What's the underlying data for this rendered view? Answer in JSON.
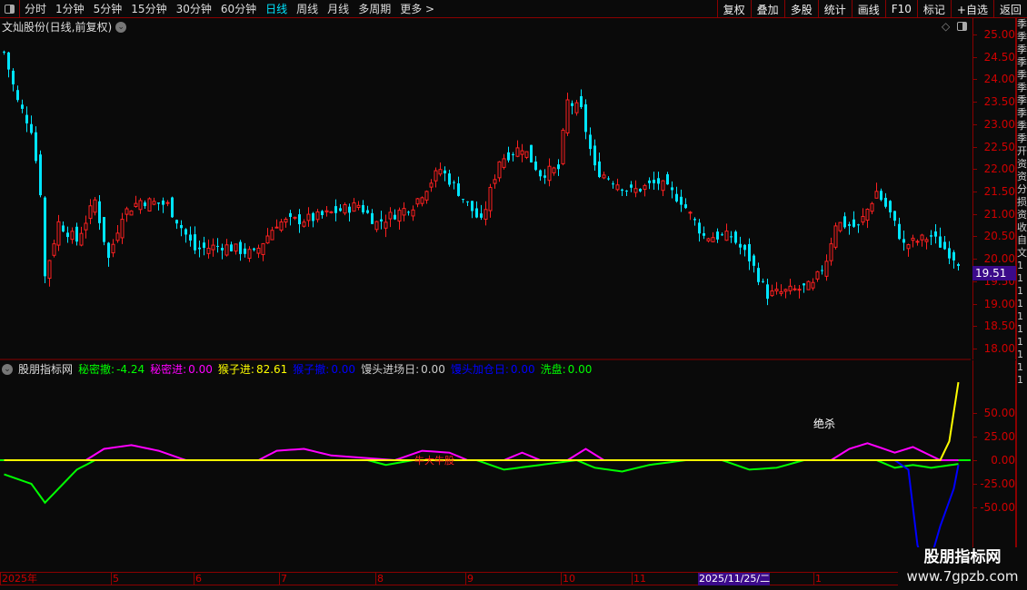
{
  "toolbar": {
    "periods": [
      "分时",
      "1分钟",
      "5分钟",
      "15分钟",
      "30分钟",
      "60分钟",
      "日线",
      "周线",
      "月线",
      "多周期",
      "更多 >"
    ],
    "active": "日线",
    "buttons": [
      "复权",
      "叠加",
      "多股",
      "统计",
      "画线",
      "F10",
      "标记",
      "+自选",
      "返回"
    ]
  },
  "title": "文灿股份(日线,前复权)",
  "price_axis": [
    "25.00",
    "24.50",
    "24.00",
    "23.50",
    "23.00",
    "22.50",
    "22.00",
    "21.50",
    "21.00",
    "20.50",
    "20.00",
    "19.50",
    "19.00",
    "18.50",
    "18.00"
  ],
  "current_price": "19.51",
  "indicator": {
    "name": "股朋指标网",
    "items": [
      {
        "label": "秘密撤:",
        "value": "-4.24",
        "color": "#00ff00"
      },
      {
        "label": "秘密进:",
        "value": "0.00",
        "color": "#ff00ff"
      },
      {
        "label": "猴子进:",
        "value": "82.61",
        "color": "#ffff00"
      },
      {
        "label": "猴子撤:",
        "value": "0.00",
        "color": "#0000ff"
      },
      {
        "label": "馒头进场日:",
        "value": "0.00",
        "color": "#cccccc"
      },
      {
        "label": "馒头加仓日:",
        "value": "0.00",
        "color": "#0000ff"
      },
      {
        "label": "洗盘:",
        "value": "0.00",
        "color": "#00ff00"
      }
    ],
    "axis": [
      "50.00",
      "25.00",
      "0.00",
      "-25.00",
      "-50.00"
    ],
    "annotations": [
      "绝杀",
      "牛大牛股"
    ]
  },
  "dates": [
    "2025年",
    "5",
    "6",
    "7",
    "8",
    "9",
    "10",
    "11",
    "2025/11/25/二",
    "1"
  ],
  "strip": "季季季季季季季季季季开资资分损资收自文1111111111",
  "watermark": {
    "title": "股朋指标网",
    "url": "www.7gpzb.com"
  },
  "colors": {
    "up": "#ff2020",
    "down": "#00e5ff",
    "grid": "#8b0000"
  },
  "chart_data": {
    "type": "candlestick",
    "price_anchors": [
      [
        0,
        24.6
      ],
      [
        3,
        23.5
      ],
      [
        6,
        22.9
      ],
      [
        8,
        21.5
      ],
      [
        9,
        19.6
      ],
      [
        12,
        20.8
      ],
      [
        16,
        20.4
      ],
      [
        20,
        21.3
      ],
      [
        23,
        20.0
      ],
      [
        26,
        21.0
      ],
      [
        30,
        21.3
      ],
      [
        36,
        21.2
      ],
      [
        42,
        20.2
      ],
      [
        48,
        20.3
      ],
      [
        55,
        20.1
      ],
      [
        60,
        20.8
      ],
      [
        68,
        20.9
      ],
      [
        78,
        21.2
      ],
      [
        82,
        20.8
      ],
      [
        90,
        21.2
      ],
      [
        96,
        22.0
      ],
      [
        100,
        21.5
      ],
      [
        105,
        20.8
      ],
      [
        109,
        22.2
      ],
      [
        114,
        22.5
      ],
      [
        118,
        21.9
      ],
      [
        122,
        22.0
      ],
      [
        124,
        23.5
      ],
      [
        127,
        23.3
      ],
      [
        130,
        22.0
      ],
      [
        138,
        21.5
      ],
      [
        144,
        21.7
      ],
      [
        149,
        21.3
      ],
      [
        154,
        20.5
      ],
      [
        160,
        20.5
      ],
      [
        164,
        20.0
      ],
      [
        168,
        19.2
      ],
      [
        174,
        19.3
      ],
      [
        178,
        19.4
      ],
      [
        181,
        20.0
      ],
      [
        183,
        20.8
      ],
      [
        188,
        20.7
      ],
      [
        192,
        21.5
      ],
      [
        195,
        21.0
      ],
      [
        198,
        20.3
      ],
      [
        204,
        20.5
      ],
      [
        210,
        19.95
      ]
    ],
    "ylim": [
      18,
      25
    ],
    "indicator_series": [
      {
        "name": "秘密进",
        "color": "#ff00ff",
        "points": [
          [
            0,
            0
          ],
          [
            18,
            0
          ],
          [
            22,
            12
          ],
          [
            28,
            16
          ],
          [
            34,
            10
          ],
          [
            40,
            0
          ],
          [
            56,
            0
          ],
          [
            60,
            10
          ],
          [
            66,
            12
          ],
          [
            72,
            5
          ],
          [
            86,
            0
          ],
          [
            92,
            10
          ],
          [
            98,
            8
          ],
          [
            102,
            0
          ],
          [
            110,
            0
          ],
          [
            114,
            8
          ],
          [
            118,
            0
          ],
          [
            124,
            0
          ],
          [
            128,
            12
          ],
          [
            132,
            0
          ],
          [
            182,
            0
          ],
          [
            186,
            12
          ],
          [
            190,
            18
          ],
          [
            196,
            8
          ],
          [
            200,
            14
          ],
          [
            206,
            0
          ],
          [
            210,
            0
          ]
        ]
      },
      {
        "name": "秘密撤",
        "color": "#00ff00",
        "points": [
          [
            0,
            -15
          ],
          [
            6,
            -25
          ],
          [
            9,
            -45
          ],
          [
            12,
            -30
          ],
          [
            16,
            -10
          ],
          [
            20,
            0
          ],
          [
            80,
            0
          ],
          [
            84,
            -5
          ],
          [
            90,
            0
          ],
          [
            104,
            0
          ],
          [
            110,
            -10
          ],
          [
            118,
            -5
          ],
          [
            126,
            0
          ],
          [
            130,
            -8
          ],
          [
            136,
            -12
          ],
          [
            142,
            -5
          ],
          [
            150,
            0
          ],
          [
            158,
            0
          ],
          [
            164,
            -10
          ],
          [
            170,
            -8
          ],
          [
            176,
            0
          ],
          [
            192,
            0
          ],
          [
            196,
            -8
          ],
          [
            200,
            -5
          ],
          [
            204,
            -8
          ],
          [
            210,
            -4
          ]
        ]
      },
      {
        "name": "猴子撤",
        "color": "#0000ff",
        "points": [
          [
            0,
            0
          ],
          [
            196,
            0
          ],
          [
            199,
            -10
          ],
          [
            201,
            -90
          ],
          [
            203,
            -120
          ],
          [
            206,
            -70
          ],
          [
            209,
            -30
          ],
          [
            210,
            -5
          ]
        ]
      },
      {
        "name": "猴子进",
        "color": "#ffff00",
        "points": [
          [
            0,
            0
          ],
          [
            206,
            0
          ],
          [
            208,
            20
          ],
          [
            210,
            82.61
          ]
        ]
      }
    ],
    "indicator_ylim": [
      -100,
      90
    ]
  }
}
